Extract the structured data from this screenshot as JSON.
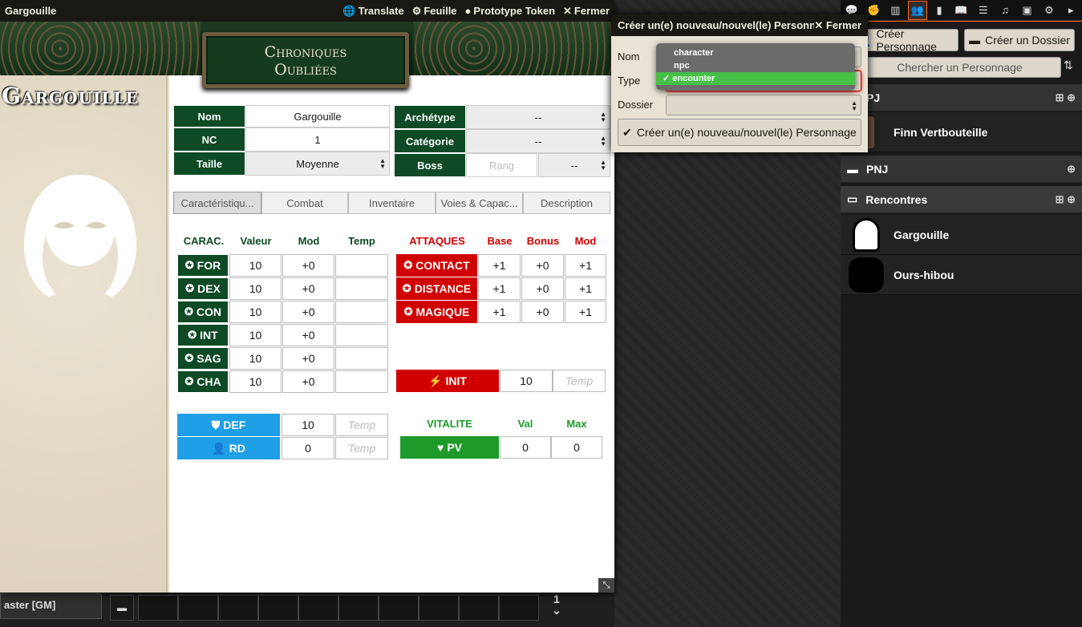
{
  "window": {
    "title": "Gargouille",
    "controls": [
      "Translate",
      "Feuille",
      "Prototype Token",
      "Fermer"
    ]
  },
  "banner": {
    "logo_line1": "Chroniques",
    "logo_line2": "Oubliées"
  },
  "character": {
    "name": "Gargouille"
  },
  "identity": {
    "nom_label": "Nom",
    "nom_value": "Gargouille",
    "nc_label": "NC",
    "nc_value": "1",
    "taille_label": "Taille",
    "taille_value": "Moyenne",
    "archetype_label": "Archétype",
    "archetype_value": "--",
    "categorie_label": "Catégorie",
    "categorie_value": "--",
    "boss_label": "Boss",
    "boss_rang_placeholder": "Rang",
    "boss_value": "--"
  },
  "tabs": [
    "Caractéristiqu...",
    "Combat",
    "Inventaire",
    "Voies & Capac...",
    "Description"
  ],
  "carac": {
    "headers": [
      "CARAC.",
      "Valeur",
      "Mod",
      "Temp"
    ],
    "rows": [
      {
        "name": "FOR",
        "value": "10",
        "mod": "+0",
        "temp": ""
      },
      {
        "name": "DEX",
        "value": "10",
        "mod": "+0",
        "temp": ""
      },
      {
        "name": "CON",
        "value": "10",
        "mod": "+0",
        "temp": ""
      },
      {
        "name": "INT",
        "value": "10",
        "mod": "+0",
        "temp": ""
      },
      {
        "name": "SAG",
        "value": "10",
        "mod": "+0",
        "temp": ""
      },
      {
        "name": "CHA",
        "value": "10",
        "mod": "+0",
        "temp": ""
      }
    ]
  },
  "attaques": {
    "headers": [
      "ATTAQUES",
      "Base",
      "Bonus",
      "Mod"
    ],
    "rows": [
      {
        "name": "CONTACT",
        "base": "+1",
        "bonus": "+0",
        "mod": "+1"
      },
      {
        "name": "DISTANCE",
        "base": "+1",
        "bonus": "+0",
        "mod": "+1"
      },
      {
        "name": "MAGIQUE",
        "base": "+1",
        "bonus": "+0",
        "mod": "+1"
      }
    ]
  },
  "init": {
    "label": "INIT",
    "value": "10",
    "temp_placeholder": "Temp"
  },
  "defense": {
    "def_label": "DEF",
    "def_value": "10",
    "def_temp": "Temp",
    "rd_label": "RD",
    "rd_value": "0",
    "rd_temp": "Temp"
  },
  "vitalite": {
    "headers": [
      "VITALITE",
      "Val",
      "Max"
    ],
    "pv_label": "PV",
    "pv_value": "0",
    "pv_max": "0"
  },
  "dialog": {
    "title": "Créer un(e) nouveau/nouvel(le) Personn",
    "close": "Fermer",
    "nom_label": "Nom",
    "type_label": "Type",
    "dossier_label": "Dossier",
    "type_options": [
      "character",
      "npc",
      "encounter"
    ],
    "type_selected": "encounter",
    "submit": "Créer un(e) nouveau/nouvel(le) Personnage"
  },
  "sidebar": {
    "create_character": "Créer Personnage",
    "create_folder": "Créer un Dossier",
    "search": "Chercher un Personnage",
    "folders": [
      {
        "name": "PJ"
      },
      {
        "name": "PNJ"
      },
      {
        "name": "Rencontres"
      }
    ],
    "pj_entries": [
      "Finn Vertbouteille"
    ],
    "rencontres_entries": [
      "Gargouille",
      "Ours-hibou"
    ]
  },
  "hotbar": {
    "player": "aster [GM]",
    "page": "1"
  },
  "colors": {
    "sheet_green": "#0d4a25",
    "attack_red": "#d10000",
    "def_blue": "#1e9fe6",
    "vital_green": "#1e9a2a",
    "active_tab_accent": "#ff6400"
  }
}
